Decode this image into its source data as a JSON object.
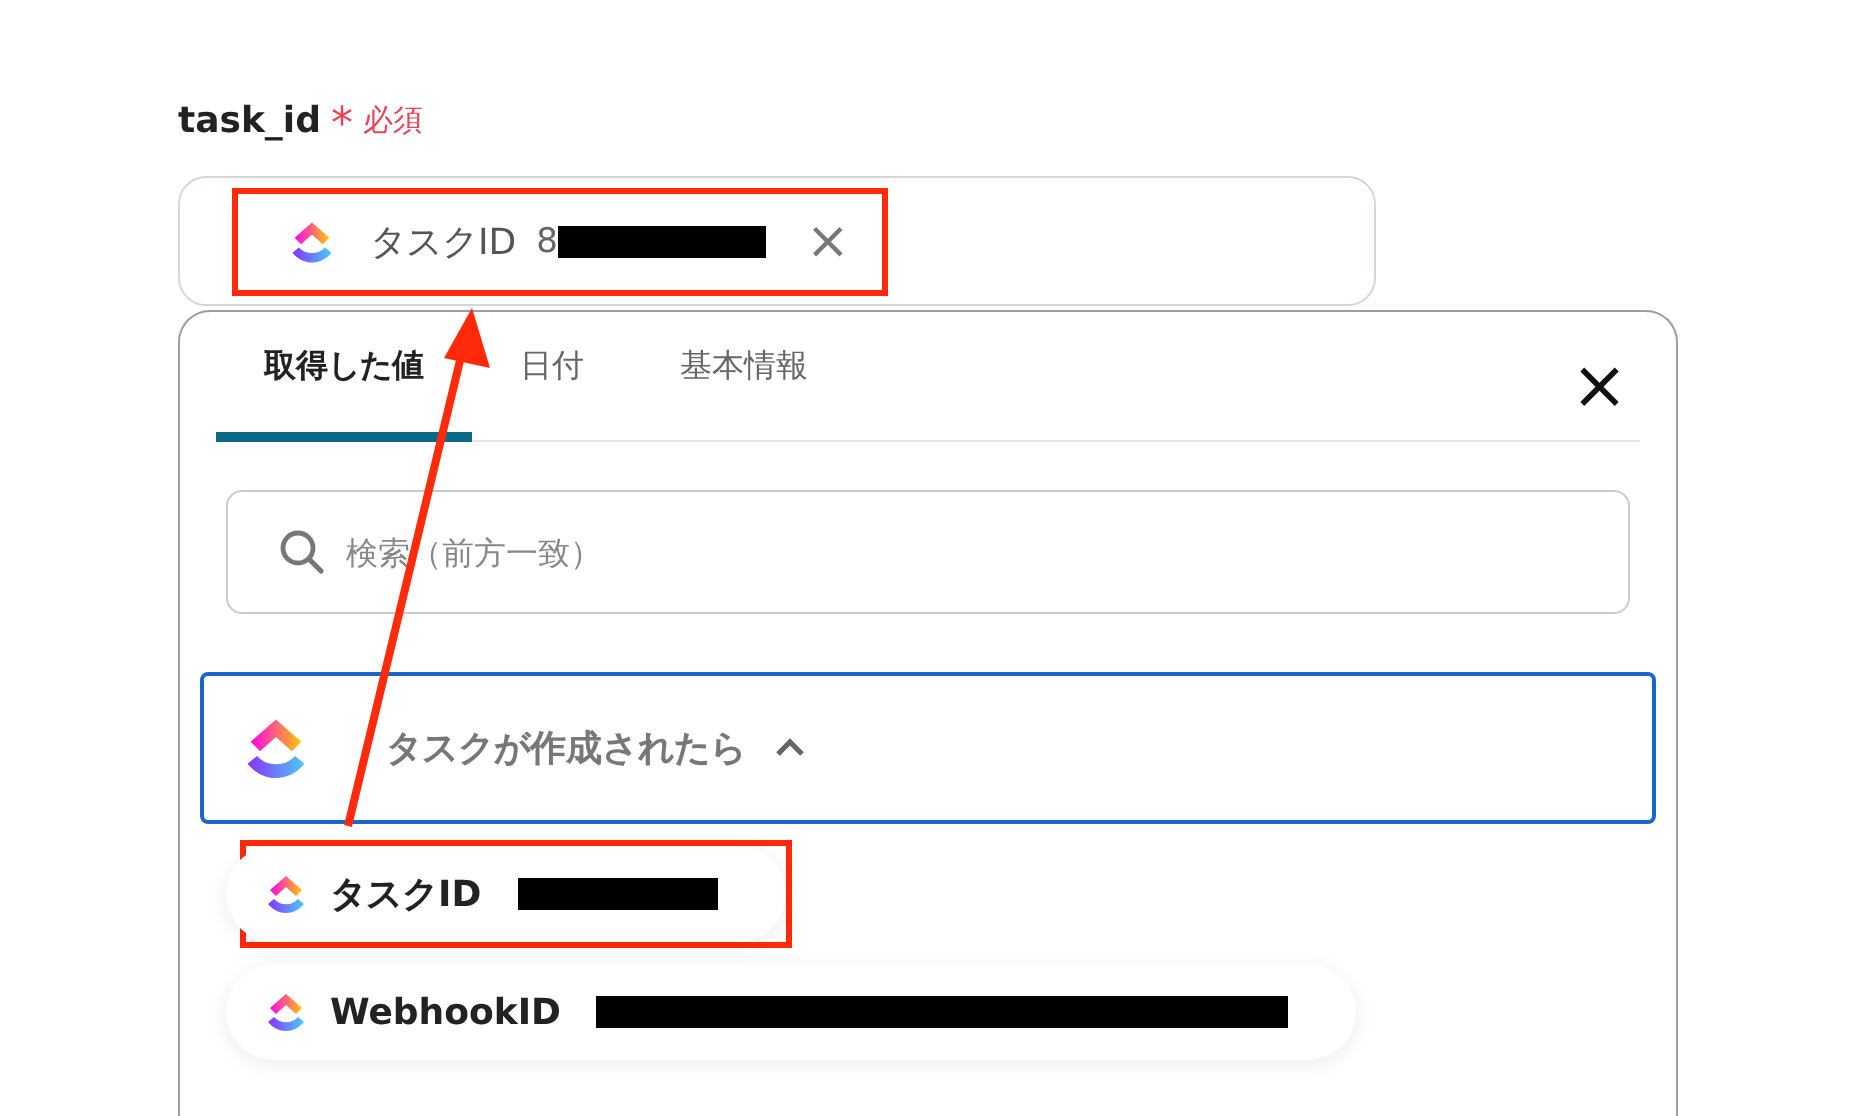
{
  "field": {
    "label": "task_id",
    "required_mark": "*",
    "required_text": "必須",
    "chip": {
      "label": "タスクID",
      "value": "8",
      "value_redacted": true,
      "remove": "×",
      "highlighted": true
    }
  },
  "panel": {
    "tabs": [
      {
        "label": "取得した値",
        "selected": true
      },
      {
        "label": "日付",
        "selected": false
      },
      {
        "label": "基本情報",
        "selected": false
      }
    ],
    "close": "×",
    "search": {
      "placeholder": "検索（前方一致）"
    },
    "group": {
      "title": "タスクが作成されたら",
      "expanded": true,
      "items": [
        {
          "label": "タスクID",
          "value_redacted": true,
          "kind": "compact",
          "highlighted": true
        },
        {
          "label": "WebhookID",
          "value_redacted": true,
          "kind": "wide",
          "highlighted": false
        }
      ]
    }
  },
  "annotation_arrow": true
}
